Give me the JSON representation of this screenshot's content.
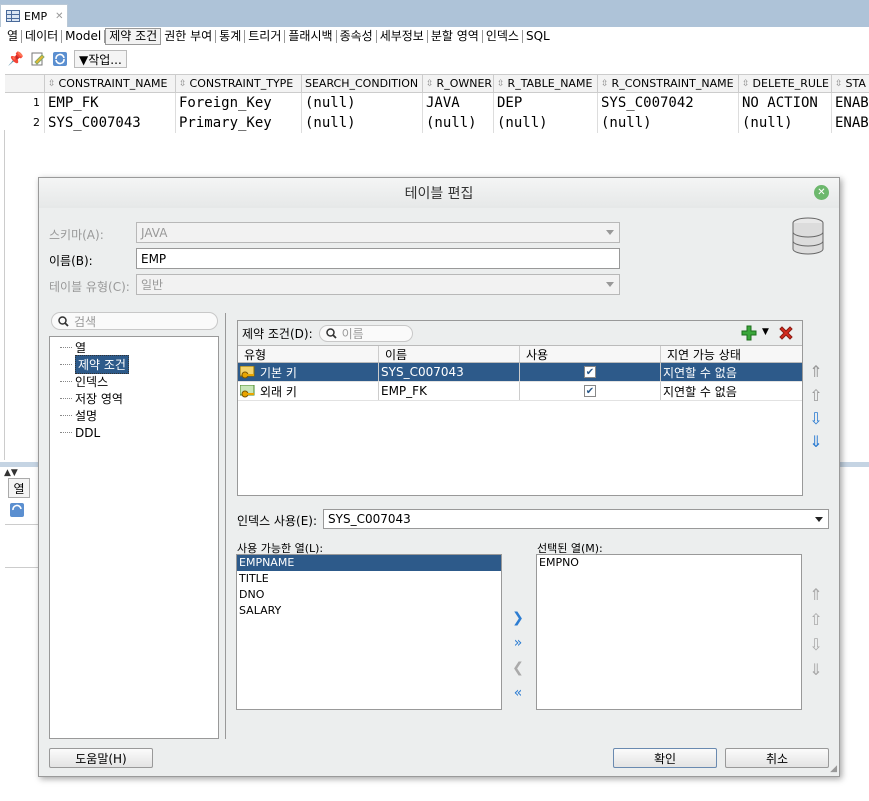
{
  "doc_tab": {
    "title": "EMP"
  },
  "sub_tabs": [
    "열",
    "데이터",
    "Model",
    "제약 조건",
    "권한 부여",
    "통계",
    "트리거",
    "플래시백",
    "종속성",
    "세부정보",
    "분할 영역",
    "인덱스",
    "SQL"
  ],
  "toolbar": {
    "actions_label": "▼작업..."
  },
  "grid": {
    "columns": [
      "CONSTRAINT_NAME",
      "CONSTRAINT_TYPE",
      "SEARCH_CONDITION",
      "R_OWNER",
      "R_TABLE_NAME",
      "R_CONSTRAINT_NAME",
      "DELETE_RULE",
      "STA"
    ],
    "rows": [
      {
        "num": "1",
        "cells": [
          "EMP_FK",
          "Foreign_Key",
          "(null)",
          "JAVA",
          "DEP",
          "SYS_C007042",
          "NO ACTION",
          "ENAB"
        ]
      },
      {
        "num": "2",
        "cells": [
          "SYS_C007043",
          "Primary_Key",
          "(null)",
          "(null)",
          "(null)",
          "(null)",
          "(null)",
          "ENAB"
        ]
      }
    ]
  },
  "bg_panel": {
    "tab_label": "열"
  },
  "dialog": {
    "title": "테이블 편집",
    "schema_label": "스키마(A):",
    "schema_value": "JAVA",
    "name_label": "이름(B):",
    "name_value": "EMP",
    "type_label": "테이블 유형(C):",
    "type_value": "일반",
    "search_placeholder": "검색",
    "tree": [
      "열",
      "제약 조건",
      "인덱스",
      "저장 영역",
      "설명",
      "DDL"
    ],
    "constraints_label": "제약 조건(D):",
    "constraints_search": "이름",
    "table_headers": [
      "유형",
      "이름",
      "사용",
      "지연 가능 상태"
    ],
    "constraints": [
      {
        "type": "기본 키",
        "name": "SYS_C007043",
        "deferrable": "지연할 수 없음"
      },
      {
        "type": "외래 키",
        "name": "EMP_FK",
        "deferrable": "지연할 수 없음"
      }
    ],
    "index_label": "인덱스 사용(E):",
    "index_value": "SYS_C007043",
    "available_label": "사용 가능한 열(L):",
    "available": [
      "EMPNAME",
      "TITLE",
      "DNO",
      "SALARY"
    ],
    "selected_label": "선택된 열(M):",
    "selected": [
      "EMPNO"
    ],
    "help_button": "도움말(H)",
    "ok_button": "확인",
    "cancel_button": "취소"
  },
  "colors": {
    "selection": "#2d5a8a",
    "title_bar": "#aec3d8",
    "dialog_bg": "#eceeee"
  }
}
